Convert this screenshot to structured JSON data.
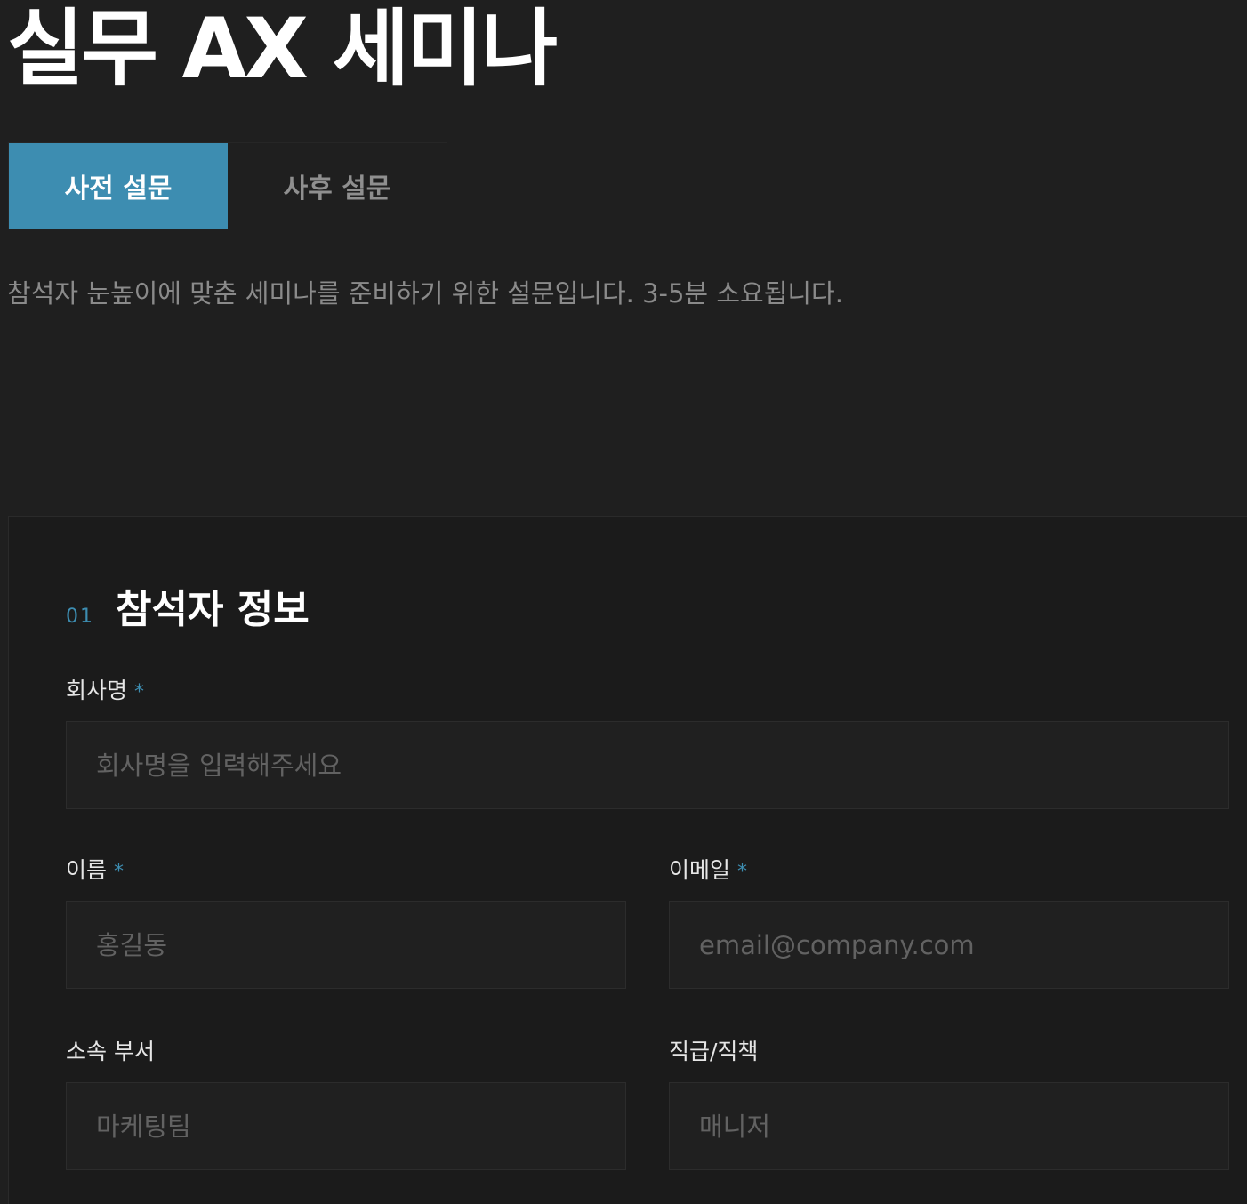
{
  "page": {
    "title": "실무 AX 세미나",
    "intro": "참석자 눈높이에 맞춘 세미나를 준비하기 위한 설문입니다. 3-5분 소요됩니다."
  },
  "tabs": [
    {
      "label": "사전 설문",
      "active": true
    },
    {
      "label": "사후 설문",
      "active": false
    }
  ],
  "section": {
    "number": "01",
    "title": "참석자 정보"
  },
  "fields": {
    "company": {
      "label": "회사명",
      "required": "*",
      "value": "",
      "placeholder": "회사명을 입력해주세요"
    },
    "name": {
      "label": "이름",
      "required": "*",
      "value": "",
      "placeholder": "홍길동"
    },
    "email": {
      "label": "이메일",
      "required": "*",
      "value": "",
      "placeholder": "email@company.com"
    },
    "department": {
      "label": "소속 부서",
      "value": "",
      "placeholder": "마케팅팀"
    },
    "position": {
      "label": "직급/직책",
      "value": "",
      "placeholder": "매니저"
    }
  },
  "colors": {
    "accent": "#3d8db1",
    "background": "#1f1f1f",
    "card": "#1b1b1b"
  }
}
